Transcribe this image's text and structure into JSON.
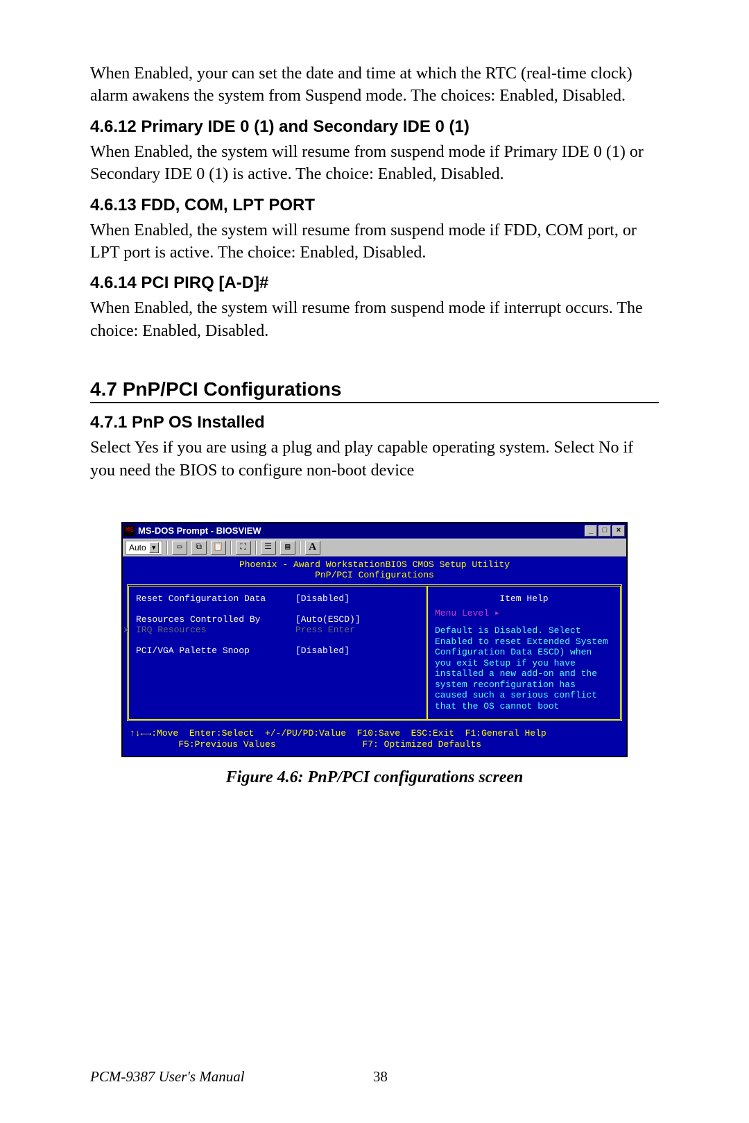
{
  "intro_para": "When Enabled, your can set the date and time at which the RTC (real-time clock) alarm awakens the system from Suspend mode. The choices: Enabled, Disabled.",
  "sections": {
    "s4612": {
      "title": "4.6.12 Primary IDE 0 (1) and Secondary IDE 0 (1)",
      "body": "When Enabled, the system will resume from suspend mode if Primary IDE 0 (1) or Secondary IDE 0 (1) is active.   The choice: Enabled, Disabled."
    },
    "s4613": {
      "title": "4.6.13 FDD, COM, LPT PORT",
      "body": "When Enabled, the system will resume from suspend mode if FDD, COM port, or LPT port is active.   The choice:  Enabled, Disabled."
    },
    "s4614": {
      "title": "4.6.14 PCI  PIRQ [A-D]#",
      "body": "When Enabled, the system will resume from suspend mode if interrupt occurs.   The choice: Enabled, Disabled."
    },
    "s47": {
      "title": "4.7  PnP/PCI Configurations"
    },
    "s471": {
      "title": "4.7.1 PnP OS Installed",
      "body": "Select Yes if you are using a plug and play capable operating system. Select No if you need the BIOS to configure non-boot device"
    }
  },
  "bios": {
    "window_title": "MS-DOS Prompt - BIOSVIEW",
    "toolbar_combo": "Auto",
    "header_line1": "Phoenix - Award WorkstationBIOS CMOS Setup Utility",
    "header_line2": "PnP/PCI Configurations",
    "items": [
      {
        "label": "Reset Configuration Data",
        "value": "[Disabled]",
        "dim": false
      },
      {
        "label": "",
        "value": "",
        "dim": false
      },
      {
        "label": "Resources Controlled By",
        "value": "[Auto(ESCD)]",
        "dim": false
      },
      {
        "label": "IRQ Resources",
        "value": "Press Enter",
        "dim": true,
        "x": "x"
      },
      {
        "label": "",
        "value": "",
        "dim": false
      },
      {
        "label": "PCI/VGA Palette Snoop",
        "value": "[Disabled]",
        "dim": false
      }
    ],
    "help": {
      "title": "Item Help",
      "menu_level": "Menu Level   ▸",
      "text": "Default is Disabled. Select Enabled to reset Extended System Configuration Data ESCD) when you exit Setup if you have installed a new add-on and the system reconfiguration has caused such a serious conflict that the OS cannot boot"
    },
    "footer_line1": "↑↓←→:Move  Enter:Select  +/-/PU/PD:Value  F10:Save  ESC:Exit  F1:General Help",
    "footer_line2": "         F5:Previous Values                F7: Optimized Defaults"
  },
  "figure_caption": "Figure 4.6: PnP/PCI configurations screen",
  "footer": {
    "manual": "PCM-9387 User's Manual",
    "page": "38"
  }
}
